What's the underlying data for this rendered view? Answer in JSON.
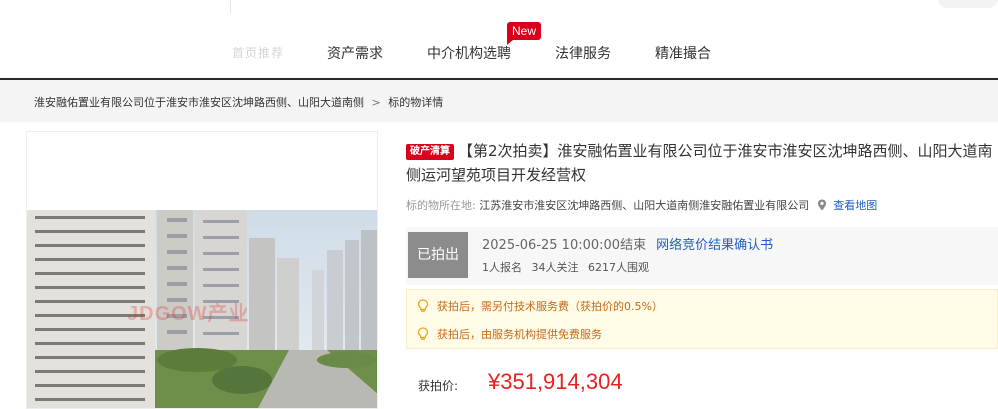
{
  "nav": {
    "faded_item": "首页推荐",
    "items": [
      "资产需求",
      "中介机构选聘",
      "法律服务",
      "精准撮合"
    ],
    "new_badge": "New"
  },
  "breadcrumb": {
    "parent": "淮安融佑置业有限公司位于淮安市淮安区沈坤路西侧、山阳大道南侧",
    "separator": ">",
    "current": "标的物详情"
  },
  "image": {
    "watermark": "JDGOW产业"
  },
  "detail": {
    "tag": "破产清算",
    "title": "【第2次拍卖】淮安融佑置业有限公司位于淮安市淮安区沈坤路西侧、山阳大道南侧运河望苑项目开发经营权",
    "location_label": "标的物所在地:",
    "location_value": "江苏淮安市淮安区沈坤路西侧、山阳大道南侧淮安融佑置业有限公司",
    "map_link": "查看地图",
    "status": "已拍出",
    "end_time": "2025-06-25 10:00:00结束",
    "result_link": "网络竞价结果确认书",
    "stats": {
      "registrations": "1人报名",
      "follows": "34人关注",
      "views": "6217人围观"
    },
    "notes": [
      "获拍后，需另付技术服务费（获拍价的0.5%）",
      "获拍后，由服务机构提供免费服务"
    ],
    "price_label": "获拍价:",
    "price": "¥351,914,304"
  },
  "colors": {
    "accent_red": "#d9001b",
    "price_red": "#e8201f",
    "link_blue": "#1f5fbf",
    "note_orange": "#c46a1a"
  }
}
